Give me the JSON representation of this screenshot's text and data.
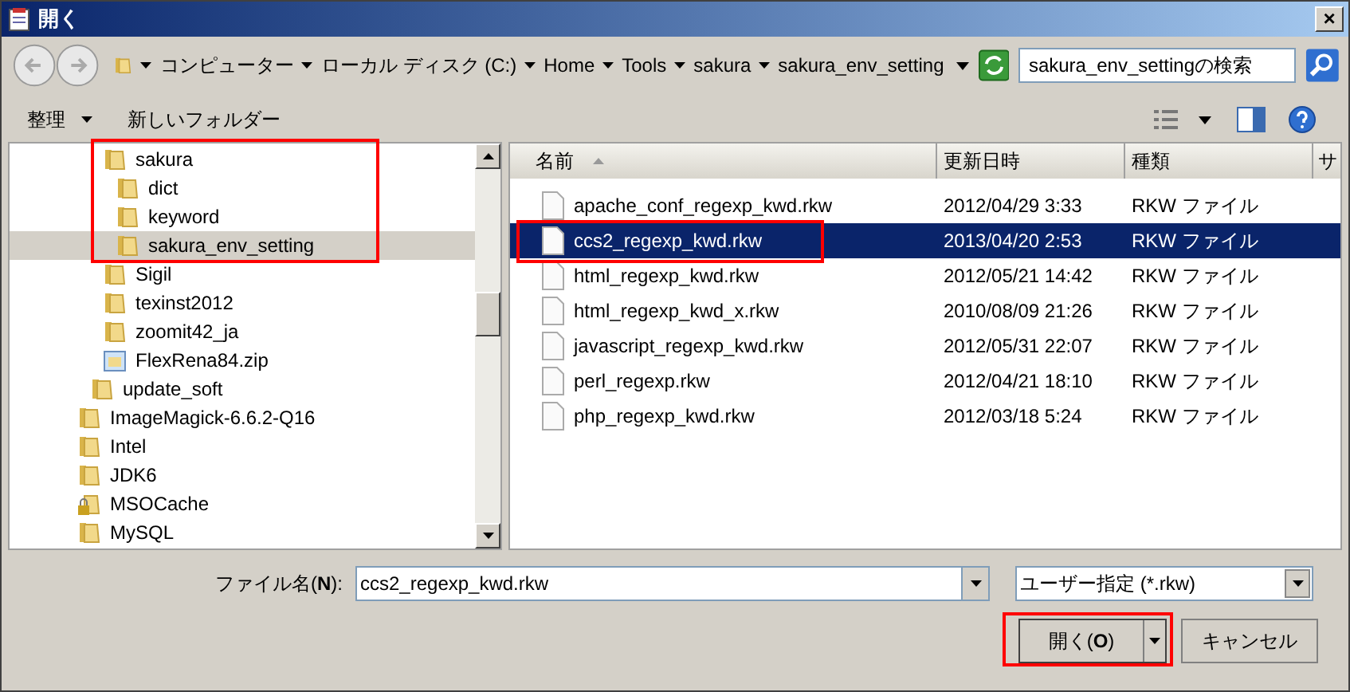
{
  "window": {
    "title": "開く",
    "close": "×"
  },
  "address": {
    "crumbs": [
      "コンピューター",
      "ローカル ディスク (C:)",
      "Home",
      "Tools",
      "sakura",
      "sakura_env_setting"
    ]
  },
  "search": {
    "placeholder": "sakura_env_settingの検索"
  },
  "toolbar": {
    "organize": "整理",
    "new_folder": "新しいフォルダー"
  },
  "tree": [
    {
      "children": [
        {
          "children": [
            {
              "label": "sakura",
              "kind": "folder",
              "selected": false,
              "children": [
                {
                  "label": "dict",
                  "kind": "folder",
                  "selected": false
                },
                {
                  "label": "keyword",
                  "kind": "folder",
                  "selected": false
                },
                {
                  "label": "sakura_env_setting",
                  "kind": "folder",
                  "selected": true
                }
              ]
            },
            {
              "label": "Sigil",
              "kind": "folder",
              "selected": false
            },
            {
              "label": "texinst2012",
              "kind": "folder",
              "selected": false
            },
            {
              "label": "zoomit42_ja",
              "kind": "folder",
              "selected": false
            },
            {
              "label": "FlexRena84.zip",
              "kind": "zip",
              "selected": false
            }
          ]
        },
        {
          "label": "update_soft",
          "kind": "folder",
          "selected": false
        }
      ]
    },
    {
      "label": "ImageMagick-6.6.2-Q16",
      "kind": "folder",
      "selected": false
    },
    {
      "label": "Intel",
      "kind": "folder",
      "selected": false
    },
    {
      "label": "JDK6",
      "kind": "folder",
      "selected": false
    },
    {
      "label": "MSOCache",
      "kind": "locked",
      "selected": false
    },
    {
      "label": "MySQL",
      "kind": "folder",
      "selected": false
    }
  ],
  "table": {
    "columns": [
      "名前",
      "更新日時",
      "種類",
      "サ"
    ],
    "rows": [
      {
        "name": "apache_conf_regexp_kwd.rkw",
        "modified": "2012/04/29 3:33",
        "type": "RKW ファイル",
        "selected": false
      },
      {
        "name": "ccs2_regexp_kwd.rkw",
        "modified": "2013/04/20 2:53",
        "type": "RKW ファイル",
        "selected": true
      },
      {
        "name": "html_regexp_kwd.rkw",
        "modified": "2012/05/21 14:42",
        "type": "RKW ファイル",
        "selected": false
      },
      {
        "name": "html_regexp_kwd_x.rkw",
        "modified": "2010/08/09 21:26",
        "type": "RKW ファイル",
        "selected": false
      },
      {
        "name": "javascript_regexp_kwd.rkw",
        "modified": "2012/05/31 22:07",
        "type": "RKW ファイル",
        "selected": false
      },
      {
        "name": "perl_regexp.rkw",
        "modified": "2012/04/21 18:10",
        "type": "RKW ファイル",
        "selected": false
      },
      {
        "name": "php_regexp_kwd.rkw",
        "modified": "2012/03/18 5:24",
        "type": "RKW ファイル",
        "selected": false
      }
    ]
  },
  "filename": {
    "label": "ファイル名(**N**):",
    "value": "ccs2_regexp_kwd.rkw"
  },
  "filter": {
    "value": "ユーザー指定 (*.rkw)"
  },
  "buttons": {
    "open": "開く(**O**)",
    "cancel": "キャンセル"
  }
}
